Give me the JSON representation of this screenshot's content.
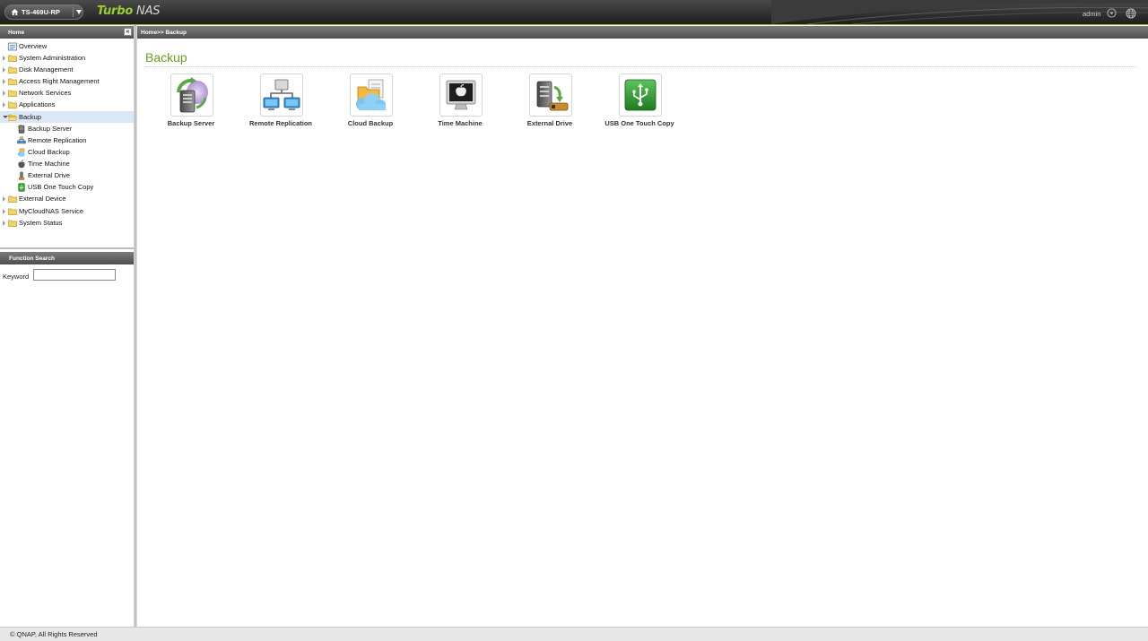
{
  "header": {
    "device_name": "TS-469U-RP",
    "brand_primary": "Turbo",
    "brand_secondary": "NAS",
    "user": "admin"
  },
  "sidebar": {
    "panel_title": "Home",
    "collapse_symbol": "«",
    "items": [
      {
        "label": "Overview",
        "icon": "overview-icon",
        "level": 0,
        "expander": "none"
      },
      {
        "label": "System Administration",
        "icon": "folder-icon",
        "level": 0,
        "expander": "collapsed"
      },
      {
        "label": "Disk Management",
        "icon": "folder-icon",
        "level": 0,
        "expander": "collapsed"
      },
      {
        "label": "Access Right Management",
        "icon": "folder-icon",
        "level": 0,
        "expander": "collapsed"
      },
      {
        "label": "Network Services",
        "icon": "folder-icon",
        "level": 0,
        "expander": "collapsed"
      },
      {
        "label": "Applications",
        "icon": "folder-icon",
        "level": 0,
        "expander": "collapsed"
      },
      {
        "label": "Backup",
        "icon": "folder-open-icon",
        "level": 0,
        "expander": "expanded",
        "selected": true
      },
      {
        "label": "Backup Server",
        "icon": "backup-server-icon",
        "level": 1,
        "expander": "none"
      },
      {
        "label": "Remote Replication",
        "icon": "remote-replication-icon",
        "level": 1,
        "expander": "none"
      },
      {
        "label": "Cloud Backup",
        "icon": "cloud-backup-icon",
        "level": 1,
        "expander": "none"
      },
      {
        "label": "Time Machine",
        "icon": "apple-icon",
        "level": 1,
        "expander": "none"
      },
      {
        "label": "External Drive",
        "icon": "external-drive-icon",
        "level": 1,
        "expander": "none"
      },
      {
        "label": "USB One Touch Copy",
        "icon": "usb-icon",
        "level": 1,
        "expander": "none"
      },
      {
        "label": "External Device",
        "icon": "folder-icon",
        "level": 0,
        "expander": "collapsed"
      },
      {
        "label": "MyCloudNAS Service",
        "icon": "folder-icon",
        "level": 0,
        "expander": "collapsed"
      },
      {
        "label": "System Status",
        "icon": "folder-icon",
        "level": 0,
        "expander": "collapsed"
      }
    ]
  },
  "search": {
    "panel_title": "Function Search",
    "keyword_label": "Keyword",
    "keyword_value": ""
  },
  "main": {
    "breadcrumb": "Home>> Backup",
    "title": "Backup",
    "tiles": [
      {
        "label": "Backup Server",
        "icon": "backup-server-icon"
      },
      {
        "label": "Remote Replication",
        "icon": "remote-replication-icon"
      },
      {
        "label": "Cloud Backup",
        "icon": "cloud-backup-icon"
      },
      {
        "label": "Time Machine",
        "icon": "time-machine-icon"
      },
      {
        "label": "External Drive",
        "icon": "external-drive-icon"
      },
      {
        "label": "USB One Touch Copy",
        "icon": "usb-one-touch-icon"
      }
    ]
  },
  "footer": {
    "copyright": "© QNAP, All Rights Reserved"
  },
  "colors": {
    "accent_green": "#6a9e1f",
    "brand_green": "#9acd32",
    "selection": "#d9e7f7",
    "header_dark": "#2a2a2a"
  }
}
